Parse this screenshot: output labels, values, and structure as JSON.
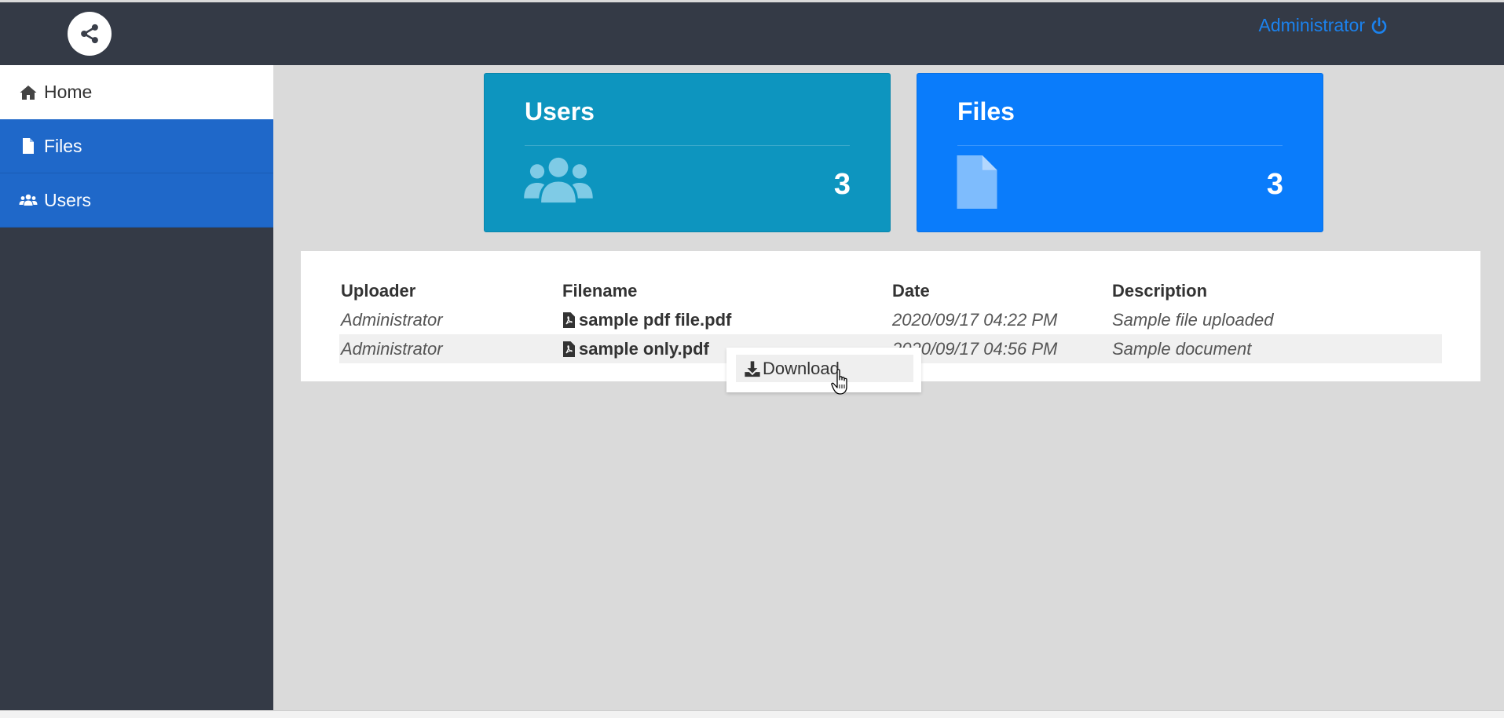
{
  "header": {
    "logo_icon": "share-icon",
    "user_label": "Administrator",
    "logout_icon": "power-icon",
    "accent": "#1b82ee"
  },
  "sidebar": {
    "items": [
      {
        "label": "Home",
        "icon": "home-icon",
        "active": true
      },
      {
        "label": "Files",
        "icon": "file-icon",
        "active": false
      },
      {
        "label": "Users",
        "icon": "users-icon",
        "active": false
      }
    ]
  },
  "cards": {
    "users": {
      "title": "Users",
      "count": "3",
      "icon": "users-icon",
      "color": "#0d95bf"
    },
    "files": {
      "title": "Files",
      "count": "3",
      "icon": "file-icon",
      "color": "#0a7cfb"
    }
  },
  "table": {
    "columns": [
      "Uploader",
      "Filename",
      "Date",
      "Description"
    ],
    "rows": [
      {
        "uploader": "Administrator",
        "filename": "sample pdf file.pdf",
        "date": "2020/09/17 04:22 PM",
        "description": "Sample file uploaded"
      },
      {
        "uploader": "Administrator",
        "filename": "sample only.pdf",
        "date": "2020/09/17 04:56 PM",
        "description": "Sample document"
      }
    ]
  },
  "context_menu": {
    "download_label": "Download",
    "download_icon": "download-icon"
  }
}
